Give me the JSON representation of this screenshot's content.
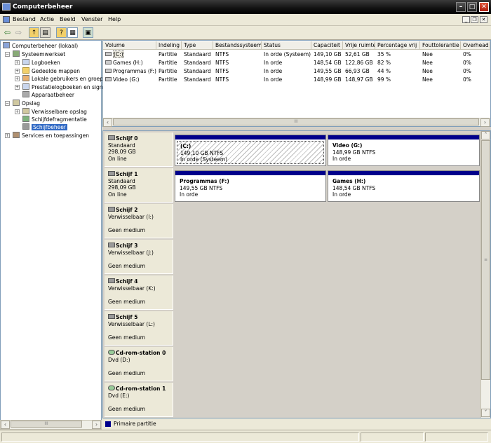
{
  "window": {
    "title": "Computerbeheer"
  },
  "menu": [
    "Bestand",
    "Actie",
    "Beeld",
    "Venster",
    "Help"
  ],
  "toolbar_icons": [
    "back-arrow-icon",
    "forward-arrow-icon",
    "up-folder-icon",
    "show-tree-icon",
    "help-icon",
    "properties-icon",
    "console-icon"
  ],
  "tree": {
    "root": "Computerbeheer (lokaal)",
    "systeemwerkset": "Systeemwerkset",
    "logboeken": "Logboeken",
    "gedeelde_mappen": "Gedeelde mappen",
    "lokale_gebruikers": "Lokale gebruikers en groepen",
    "prestatielogboeken": "Prestatielogboeken en signaleringen",
    "apparaatbeheer": "Apparaatbeheer",
    "opslag": "Opslag",
    "verwisselbare_opslag": "Verwisselbare opslag",
    "schijfdefragmentatie": "Schijfdefragmentatie",
    "schijfbeheer": "Schijfbeheer",
    "services": "Services en toepassingen"
  },
  "volumes": {
    "columns": [
      "Volume",
      "Indeling",
      "Type",
      "Bestandssysteem",
      "Status",
      "Capaciteit",
      "Vrije ruimte",
      "Percentage vrij",
      "Fouttolerantie",
      "Overhead"
    ],
    "rows": [
      {
        "volume": "(C:)",
        "indeling": "Partitie",
        "type": "Standaard",
        "fs": "NTFS",
        "status": "In orde (Systeem)",
        "capaciteit": "149,10 GB",
        "vrij": "52,61 GB",
        "pct": "35 %",
        "fout": "Nee",
        "overhead": "0%"
      },
      {
        "volume": "Games (H:)",
        "indeling": "Partitie",
        "type": "Standaard",
        "fs": "NTFS",
        "status": "In orde",
        "capaciteit": "148,54 GB",
        "vrij": "122,86 GB",
        "pct": "82 %",
        "fout": "Nee",
        "overhead": "0%"
      },
      {
        "volume": "Programmas (F:)",
        "indeling": "Partitie",
        "type": "Standaard",
        "fs": "NTFS",
        "status": "In orde",
        "capaciteit": "149,55 GB",
        "vrij": "66,93 GB",
        "pct": "44 %",
        "fout": "Nee",
        "overhead": "0%"
      },
      {
        "volume": "Video (G:)",
        "indeling": "Partitie",
        "type": "Standaard",
        "fs": "NTFS",
        "status": "In orde",
        "capaciteit": "148,99 GB",
        "vrij": "148,97 GB",
        "pct": "99 %",
        "fout": "Nee",
        "overhead": "0%"
      }
    ]
  },
  "disks": [
    {
      "name": "Schijf 0",
      "l1": "Standaard",
      "l2": "298,09 GB",
      "l3": "On line"
    },
    {
      "name": "Schijf 1",
      "l1": "Standaard",
      "l2": "298,09 GB",
      "l3": "On line"
    },
    {
      "name": "Schijf 2",
      "l1": "Verwisselbaar (I:)",
      "l2": "",
      "l3": "Geen medium"
    },
    {
      "name": "Schijf 3",
      "l1": "Verwisselbaar (J:)",
      "l2": "",
      "l3": "Geen medium"
    },
    {
      "name": "Schijf 4",
      "l1": "Verwisselbaar (K:)",
      "l2": "",
      "l3": "Geen medium"
    },
    {
      "name": "Schijf 5",
      "l1": "Verwisselbaar (L:)",
      "l2": "",
      "l3": "Geen medium"
    },
    {
      "name": "Cd-rom-station 0",
      "l1": "Dvd (D:)",
      "l2": "",
      "l3": "Geen medium"
    },
    {
      "name": "Cd-rom-station 1",
      "l1": "Dvd (E:)",
      "l2": "",
      "l3": "Geen medium"
    }
  ],
  "partitions": {
    "c": {
      "name": "(C:)",
      "size": "149,10 GB NTFS",
      "status": "In orde (Systeem)"
    },
    "g": {
      "name": "Video  (G:)",
      "size": "148,99 GB NTFS",
      "status": "In orde"
    },
    "f": {
      "name": "Programmas  (F:)",
      "size": "149,55 GB NTFS",
      "status": "In orde"
    },
    "h": {
      "name": "Games  (H:)",
      "size": "148,54 GB NTFS",
      "status": "In orde"
    }
  },
  "legend": {
    "primaire": "Primaire partitie",
    "primaire_color": "#00008b"
  },
  "scroll": {
    "h_mid": "III",
    "v_mid": "≡"
  }
}
